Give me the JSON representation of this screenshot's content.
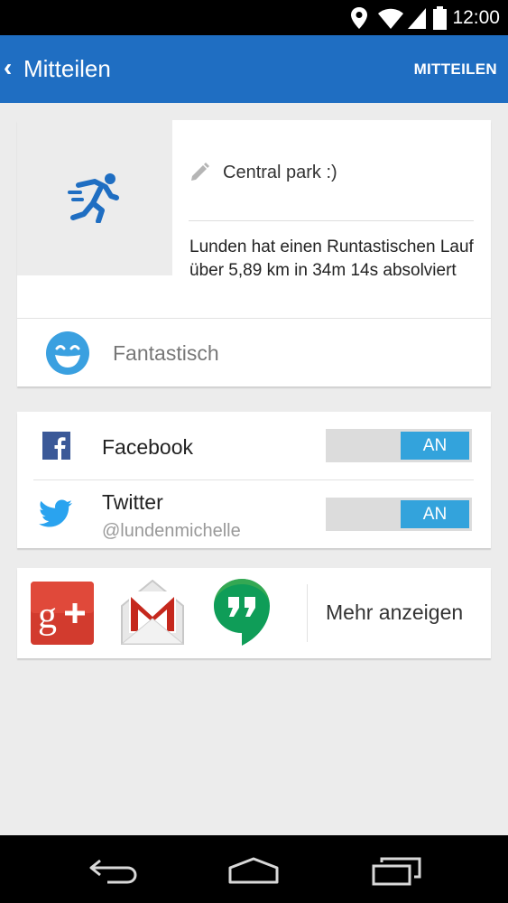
{
  "status_bar": {
    "time": "12:00"
  },
  "app_bar": {
    "back_glyph": "‹",
    "title": "Mitteilen",
    "action_label": "MITTEILEN"
  },
  "activity": {
    "note": "Central park :)",
    "summary": "Lunden hat einen Runtastischen Lauf über 5,89 km in 34m 14s absolviert",
    "mood": "Fantastisch",
    "icons": [
      "runner-icon",
      "pencil-icon",
      "smiley-icon"
    ]
  },
  "networks": [
    {
      "name": "Facebook",
      "handle": "",
      "toggle": "AN",
      "icon": "facebook-icon"
    },
    {
      "name": "Twitter",
      "handle": "@lundenmichelle",
      "toggle": "AN",
      "icon": "twitter-icon"
    }
  ],
  "share": {
    "apps": [
      "google-plus-icon",
      "gmail-icon",
      "hangouts-icon"
    ],
    "more_label": "Mehr anzeigen"
  },
  "colors": {
    "app_bar": "#1f6ec2",
    "toggle_on": "#33a3dc",
    "mood_face": "#3aa0e0"
  }
}
